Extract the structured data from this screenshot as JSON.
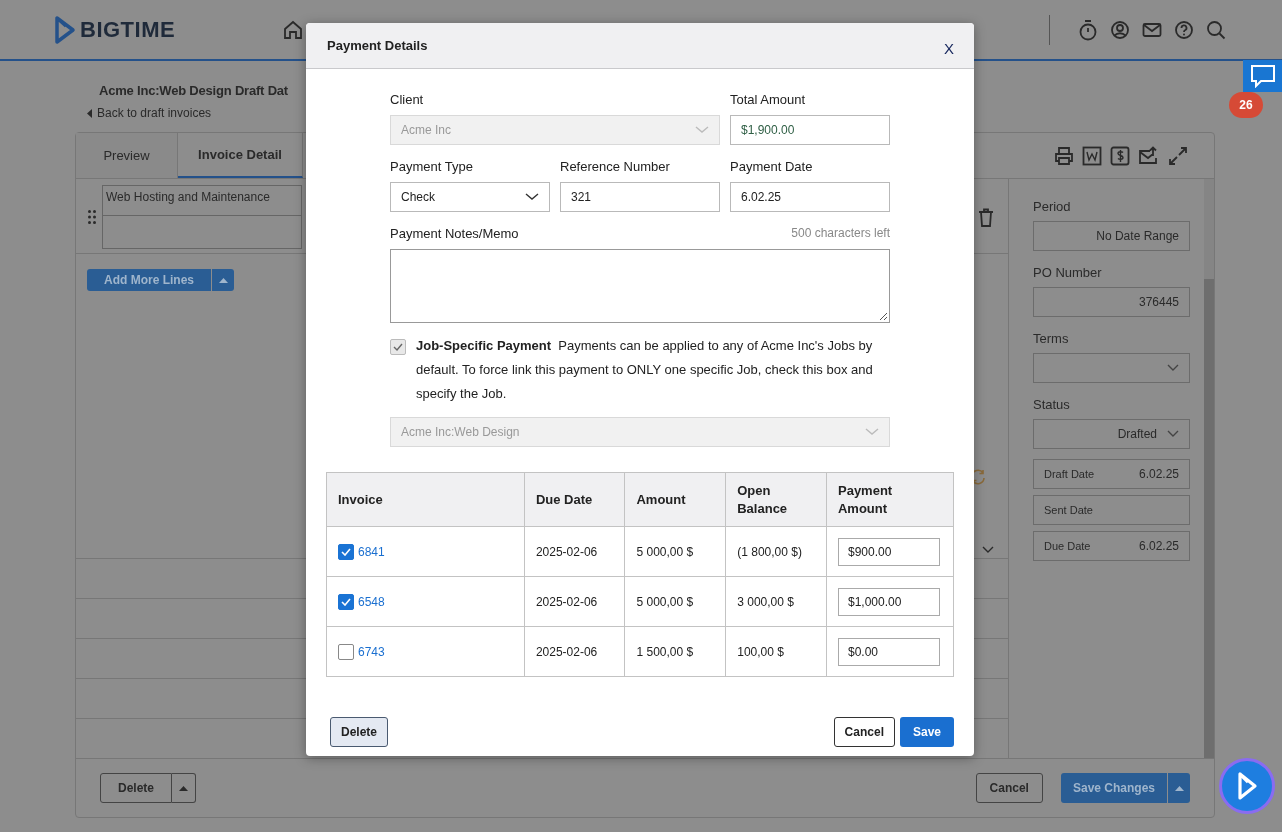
{
  "app": {
    "logo": "BIGTIME"
  },
  "page": {
    "title": "Acme Inc:Web Design Draft Dat",
    "back_link": "Back to draft invoices"
  },
  "tabs": [
    {
      "label": "Preview",
      "selected": false
    },
    {
      "label": "Invoice Detail",
      "selected": true
    }
  ],
  "line_items": [
    {
      "description": "Web Hosting and Maintenance"
    }
  ],
  "add_lines_button": "Add More Lines",
  "side_panel": [
    {
      "kind": "text",
      "label": "Period",
      "value": "No Date Range"
    },
    {
      "kind": "text",
      "label": "PO Number",
      "value": "376445"
    },
    {
      "kind": "select",
      "label": "Terms"
    },
    {
      "kind": "select",
      "label": "Status",
      "value": "Drafted"
    },
    {
      "kind": "inline",
      "label": "Draft Date",
      "value": "6.02.25"
    },
    {
      "kind": "inline",
      "label": "Sent Date"
    },
    {
      "kind": "inline",
      "label": "Due Date",
      "value": "6.02.25"
    }
  ],
  "footer": {
    "delete": "Delete",
    "cancel": "Cancel",
    "save": "Save Changes"
  },
  "chat_badge": "26",
  "dialog": {
    "title": "Payment Details",
    "close": "X",
    "client": {
      "label": "Client",
      "value": "Acme Inc",
      "disabled": true
    },
    "total_amount": {
      "label": "Total Amount",
      "value": "$1,900.00"
    },
    "payment_type": {
      "label": "Payment Type",
      "value": "Check",
      "disabled": false
    },
    "reference_number": {
      "label": "Reference Number",
      "value": "321"
    },
    "payment_date": {
      "label": "Payment Date",
      "value": "6.02.25"
    },
    "notes": {
      "label": "Payment Notes/Memo",
      "counter": "500 characters left"
    },
    "job_specific": {
      "checked": true,
      "label": "Job-Specific Payment",
      "description": "Payments can be applied to any of Acme Inc's Jobs by default. To force link this payment to ONLY one specific Job, check this box and specify the Job."
    },
    "job_select": {
      "value": "Acme Inc:Web Design",
      "disabled": true
    },
    "table": {
      "columns": [
        "Invoice",
        "Due Date",
        "Amount",
        "Open Balance",
        "Payment Amount"
      ],
      "rows": [
        {
          "checked": true,
          "invoice": "6841",
          "due_date": "2025-02-06",
          "amount": "5 000,00 $",
          "open_balance": "(1 800,00 $)",
          "payment_amount": "$900.00"
        },
        {
          "checked": true,
          "invoice": "6548",
          "due_date": "2025-02-06",
          "amount": "5 000,00 $",
          "open_balance": "3 000,00 $",
          "payment_amount": "$1,000.00"
        },
        {
          "checked": false,
          "invoice": "6743",
          "due_date": "2025-02-06",
          "amount": "1 500,00 $",
          "open_balance": "100,00 $",
          "payment_amount": "$0.00"
        }
      ]
    },
    "buttons": {
      "delete": "Delete",
      "cancel": "Cancel",
      "save": "Save"
    }
  }
}
